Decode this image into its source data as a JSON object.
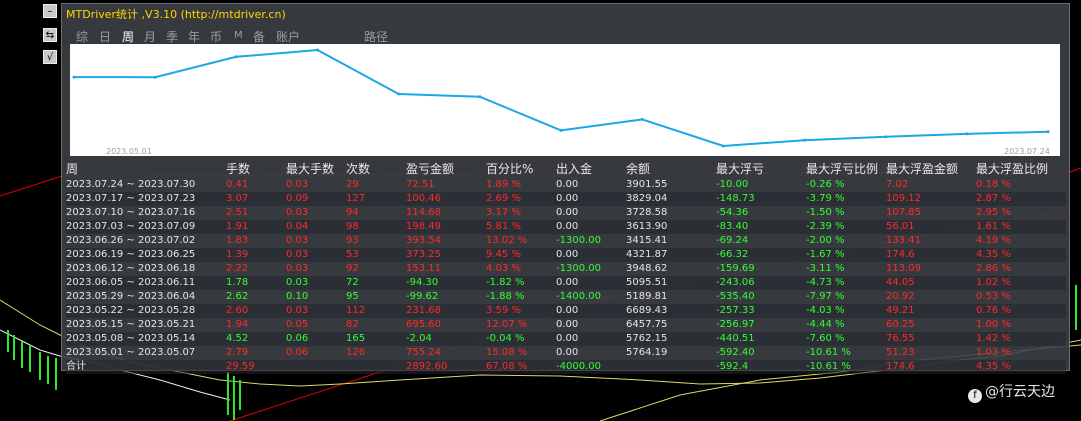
{
  "window": {
    "title": "MTDriver统计 ,V3.10 (http://mtdriver.cn)"
  },
  "side_buttons": [
    "–",
    "⇆",
    "√"
  ],
  "tabs": [
    {
      "label": "综",
      "active": false
    },
    {
      "label": "日",
      "active": false
    },
    {
      "label": "周",
      "active": true
    },
    {
      "label": "月",
      "active": false
    },
    {
      "label": "季",
      "active": false
    },
    {
      "label": "年",
      "active": false
    },
    {
      "label": "币",
      "active": false
    },
    {
      "label": "M",
      "active": false
    },
    {
      "label": "备",
      "active": false
    },
    {
      "label": "账户",
      "active": false
    },
    {
      "label": "路径",
      "active": false
    }
  ],
  "colors": {
    "loss": "#ff2a2a",
    "profit": "#33ff33",
    "neutral": "#e6e6e6",
    "curve": "#19a7e6",
    "title": "#ffd700"
  },
  "equity_chart": {
    "start_label": "2023.05.01",
    "end_label": "2023.07.24",
    "chart_data": {
      "type": "line",
      "x": [
        "2023.05.01",
        "2023.05.08",
        "2023.05.15",
        "2023.05.22",
        "2023.05.29",
        "2023.06.05",
        "2023.06.12",
        "2023.06.19",
        "2023.06.26",
        "2023.07.03",
        "2023.07.10",
        "2023.07.17",
        "2023.07.24"
      ],
      "values": [
        5764.19,
        5762.15,
        6457.75,
        6689.43,
        5189.81,
        5095.51,
        3948.62,
        4321.87,
        3415.41,
        3613.9,
        3728.58,
        3829.04,
        3901.55
      ]
    }
  },
  "table": {
    "headers": [
      "周",
      "手数",
      "最大手数",
      "次数",
      "盈亏金额",
      "百分比%",
      "出入金",
      "余额",
      "最大浮亏",
      "最大浮亏比例",
      "最大浮盈金额",
      "最大浮盈比例"
    ],
    "rows": [
      {
        "cells": [
          "2023.07.24 ~ 2023.07.30",
          "0.41",
          "0.03",
          "29",
          "72.51",
          "1.89 %",
          "0.00",
          "3901.55",
          "-10.00",
          "-0.26 %",
          "7.02",
          "0.18 %"
        ],
        "colors": [
          "w",
          "r",
          "r",
          "r",
          "r",
          "r",
          "w",
          "w",
          "g",
          "g",
          "r",
          "r"
        ]
      },
      {
        "cells": [
          "2023.07.17 ~ 2023.07.23",
          "3.07",
          "0.09",
          "127",
          "100.46",
          "2.69 %",
          "0.00",
          "3829.04",
          "-148.73",
          "-3.79 %",
          "109.12",
          "2.87 %"
        ],
        "colors": [
          "w",
          "r",
          "r",
          "r",
          "r",
          "r",
          "w",
          "w",
          "g",
          "g",
          "r",
          "r"
        ]
      },
      {
        "cells": [
          "2023.07.10 ~ 2023.07.16",
          "2.51",
          "0.03",
          "94",
          "114.68",
          "3.17 %",
          "0.00",
          "3728.58",
          "-54.36",
          "-1.50 %",
          "107.85",
          "2.95 %"
        ],
        "colors": [
          "w",
          "r",
          "r",
          "r",
          "r",
          "r",
          "w",
          "w",
          "g",
          "g",
          "r",
          "r"
        ]
      },
      {
        "cells": [
          "2023.07.03 ~ 2023.07.09",
          "1.91",
          "0.04",
          "98",
          "198.49",
          "5.81 %",
          "0.00",
          "3613.90",
          "-83.40",
          "-2.39 %",
          "56.01",
          "1.61 %"
        ],
        "colors": [
          "w",
          "r",
          "r",
          "r",
          "r",
          "r",
          "w",
          "w",
          "g",
          "g",
          "r",
          "r"
        ]
      },
      {
        "cells": [
          "2023.06.26 ~ 2023.07.02",
          "1.83",
          "0.03",
          "93",
          "393.54",
          "13.02 %",
          "-1300.00",
          "3415.41",
          "-69.24",
          "-2.00 %",
          "133.41",
          "4.19 %"
        ],
        "colors": [
          "w",
          "r",
          "r",
          "r",
          "r",
          "r",
          "g",
          "w",
          "g",
          "g",
          "r",
          "r"
        ]
      },
      {
        "cells": [
          "2023.06.19 ~ 2023.06.25",
          "1.39",
          "0.03",
          "53",
          "373.25",
          "9.45 %",
          "0.00",
          "4321.87",
          "-66.32",
          "-1.67 %",
          "174.6",
          "4.35 %"
        ],
        "colors": [
          "w",
          "r",
          "r",
          "r",
          "r",
          "r",
          "w",
          "w",
          "g",
          "g",
          "r",
          "r"
        ]
      },
      {
        "cells": [
          "2023.06.12 ~ 2023.06.18",
          "2.22",
          "0.03",
          "92",
          "153.11",
          "4.03 %",
          "-1300.00",
          "3948.62",
          "-159.69",
          "-3.11 %",
          "113.09",
          "2.86 %"
        ],
        "colors": [
          "w",
          "r",
          "r",
          "r",
          "r",
          "r",
          "g",
          "w",
          "g",
          "g",
          "r",
          "r"
        ]
      },
      {
        "cells": [
          "2023.06.05 ~ 2023.06.11",
          "1.78",
          "0.03",
          "72",
          "-94.30",
          "-1.82 %",
          "0.00",
          "5095.51",
          "-243.06",
          "-4.73 %",
          "44.05",
          "1.02 %"
        ],
        "colors": [
          "w",
          "g",
          "g",
          "g",
          "g",
          "g",
          "w",
          "w",
          "g",
          "g",
          "r",
          "r"
        ]
      },
      {
        "cells": [
          "2023.05.29 ~ 2023.06.04",
          "2.62",
          "0.10",
          "95",
          "-99.62",
          "-1.88 %",
          "-1400.00",
          "5189.81",
          "-535.40",
          "-7.97 %",
          "20.92",
          "0.53 %"
        ],
        "colors": [
          "w",
          "g",
          "g",
          "g",
          "g",
          "g",
          "g",
          "w",
          "g",
          "g",
          "r",
          "r"
        ]
      },
      {
        "cells": [
          "2023.05.22 ~ 2023.05.28",
          "2.60",
          "0.03",
          "112",
          "231.68",
          "3.59 %",
          "0.00",
          "6689.43",
          "-257.33",
          "-4.03 %",
          "49.21",
          "0.76 %"
        ],
        "colors": [
          "w",
          "r",
          "r",
          "r",
          "r",
          "r",
          "w",
          "w",
          "g",
          "g",
          "r",
          "r"
        ]
      },
      {
        "cells": [
          "2023.05.15 ~ 2023.05.21",
          "1.94",
          "0.05",
          "82",
          "695.60",
          "12.07 %",
          "0.00",
          "6457.75",
          "-256.97",
          "-4.44 %",
          "60.25",
          "1.00 %"
        ],
        "colors": [
          "w",
          "r",
          "r",
          "r",
          "r",
          "r",
          "w",
          "w",
          "g",
          "g",
          "r",
          "r"
        ]
      },
      {
        "cells": [
          "2023.05.08 ~ 2023.05.14",
          "4.52",
          "0.06",
          "165",
          "-2.04",
          "-0.04 %",
          "0.00",
          "5762.15",
          "-440.51",
          "-7.60 %",
          "76.55",
          "1.42 %"
        ],
        "colors": [
          "w",
          "g",
          "g",
          "g",
          "g",
          "g",
          "w",
          "w",
          "g",
          "g",
          "r",
          "r"
        ]
      },
      {
        "cells": [
          "2023.05.01 ~ 2023.05.07",
          "2.79",
          "0.06",
          "126",
          "755.24",
          "15.08 %",
          "0.00",
          "5764.19",
          "-592.40",
          "-10.61 %",
          "51.23",
          "1.03 %"
        ],
        "colors": [
          "w",
          "r",
          "r",
          "r",
          "r",
          "r",
          "w",
          "w",
          "g",
          "g",
          "r",
          "r"
        ]
      }
    ],
    "total": {
      "cells": [
        "合计",
        "29.59",
        "",
        "",
        "2892.60",
        "67.08 %",
        "-4000.00",
        "",
        "-592.4",
        "-10.61 %",
        "174.6",
        "4.35 %"
      ],
      "colors": [
        "w",
        "r",
        "r",
        "r",
        "r",
        "r",
        "g",
        "w",
        "g",
        "g",
        "r",
        "r"
      ]
    }
  },
  "watermark": "@行云天边"
}
